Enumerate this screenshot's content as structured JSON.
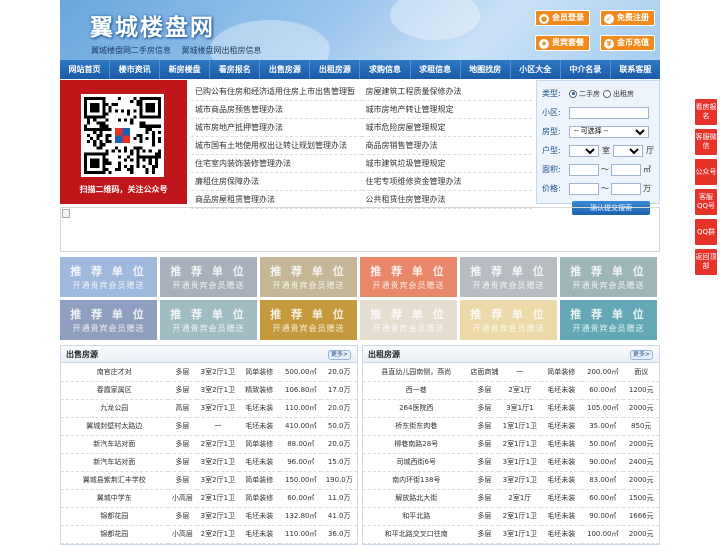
{
  "header": {
    "logo": "翼城楼盘网",
    "subtitle1": "翼城楼盘网二手房信息",
    "subtitle2": "翼城楼盘网出租房信息",
    "buttons": [
      {
        "icon": "user-icon",
        "label": "会员登录"
      },
      {
        "icon": "register-icon",
        "label": "免费注册"
      },
      {
        "icon": "package-icon",
        "label": "贵宾套餐"
      },
      {
        "icon": "coin-icon",
        "label": "金币充值"
      }
    ]
  },
  "nav": [
    "网站首页",
    "楼市资讯",
    "新房楼盘",
    "看房报名",
    "出售房源",
    "出租房源",
    "求购信息",
    "求租信息",
    "地图找房",
    "小区大全",
    "中介名录",
    "联系客服"
  ],
  "qr": {
    "caption": "扫描二维码，关注公众号"
  },
  "links": {
    "col1": [
      "已购公有住房和经济适用住房上市出售管理暂",
      "城市商品房预售管理办法",
      "城市房地产抵押管理办法",
      "城市国有土地使用权出让转让规划管理办法",
      "住宅室内装饰装修管理办法",
      "廉租住房保障办法",
      "商品房屋租赁管理办法"
    ],
    "col2": [
      "房屋建筑工程质量保修办法",
      "城市房地产转让管理规定",
      "城市危险房屋管理规定",
      "商品房销售管理办法",
      "城市建筑垃圾管理规定",
      "住宅专项维修资金管理办法",
      "公共租赁住房管理办法"
    ]
  },
  "search": {
    "type_label": "类型:",
    "opt1": "二手房",
    "opt2": "出租房",
    "community_label": "小区:",
    "house_label": "房型:",
    "house_select": "-- 可选择 --",
    "layout_label": "户型:",
    "room_unit": "室",
    "hall_unit": "厅",
    "area_label": "面积:",
    "area_unit": "㎡",
    "price_label": "价格:",
    "price_unit": "万",
    "submit": "确认提交搜索"
  },
  "recommend": {
    "title": "推 荐 单 位",
    "sub": "开通贵宾会员赠送",
    "colors": [
      "#9fb8de",
      "#a8b0bb",
      "#c5b796",
      "#e8876a",
      "#b7bcc2",
      "#9fb6b9",
      "#8f9fbf",
      "#9fbcc2",
      "#c49a3d",
      "#e5ddd0",
      "#ecd8a8",
      "#64a8b8"
    ]
  },
  "sale": {
    "title": "出售房源",
    "more": "更多>",
    "rows": [
      [
        "南官庄才对",
        "多层",
        "3室2厅1卫",
        "简单装修",
        "500.00㎡",
        "20.0万"
      ],
      [
        "春霞家属区",
        "多层",
        "3室2厅1卫",
        "精致装修",
        "106.80㎡",
        "17.0万"
      ],
      [
        "九龙公园",
        "高层",
        "3室2厅1卫",
        "毛坯未装",
        "110.00㎡",
        "20.0万"
      ],
      [
        "翼城封壁村太路边",
        "多层",
        "一",
        "毛坯未装",
        "410.00㎡",
        "50.0万"
      ],
      [
        "新汽车站对面",
        "多层",
        "2室2厅1卫",
        "简单装修",
        "88.00㎡",
        "20.0万"
      ],
      [
        "新汽车站对面",
        "多层",
        "3室2厅1卫",
        "毛坯未装",
        "96.00㎡",
        "15.0万"
      ],
      [
        "翼城县紫荆汇丰学校",
        "多层",
        "3室2厅1卫",
        "简单装修",
        "150.00㎡",
        "190.0万"
      ],
      [
        "翼城中学东",
        "小高层",
        "2室1厅1卫",
        "简单装修",
        "60.00㎡",
        "11.0万"
      ],
      [
        "锦都花园",
        "多层",
        "3室2厅1卫",
        "毛坯未装",
        "132.80㎡",
        "41.0万"
      ],
      [
        "锦都花园",
        "小高层",
        "2室2厅1卫",
        "毛坯未装",
        "110.00㎡",
        "36.0万"
      ]
    ]
  },
  "rent": {
    "title": "出租房源",
    "more": "更多>",
    "rows": [
      [
        "县直幼儿园南侧，燕尚",
        "店面商铺",
        "一",
        "简单装修",
        "200.00㎡",
        "面议"
      ],
      [
        "西一巷",
        "多层",
        "2室1厅",
        "毛坯未装",
        "60.00㎡",
        "1200元"
      ],
      [
        "264医院西",
        "多层",
        "3室1厅1",
        "毛坯未装",
        "105.00㎡",
        "2000元"
      ],
      [
        "桥东街东肉巷",
        "多层",
        "1室1厅1卫",
        "毛坯未装",
        "35.00㎡",
        "850元"
      ],
      [
        "柳巷南路28号",
        "多层",
        "2室1厅1卫",
        "毛坯未装",
        "50.00㎡",
        "2000元"
      ],
      [
        "司城西街6号",
        "多层",
        "3室1厅1卫",
        "毛坯未装",
        "90.00㎡",
        "2400元"
      ],
      [
        "南内环街138号",
        "多层",
        "3室2厅1卫",
        "毛坯未装",
        "83.00㎡",
        "2000元"
      ],
      [
        "解放路北大街",
        "多层",
        "2室1厅",
        "毛坯未装",
        "60.00㎡",
        "1500元"
      ],
      [
        "和平北路",
        "多层",
        "2室1厅1卫",
        "毛坯未装",
        "90.00㎡",
        "1666元"
      ],
      [
        "和平北路交叉口往南",
        "多层",
        "3室1厅1卫",
        "毛坯未装",
        "100.00㎡",
        "2000元"
      ]
    ]
  },
  "side": [
    "看房报名",
    "客服微信",
    "公众号",
    "客服QQ号",
    "QQ群",
    "返回顶部"
  ]
}
